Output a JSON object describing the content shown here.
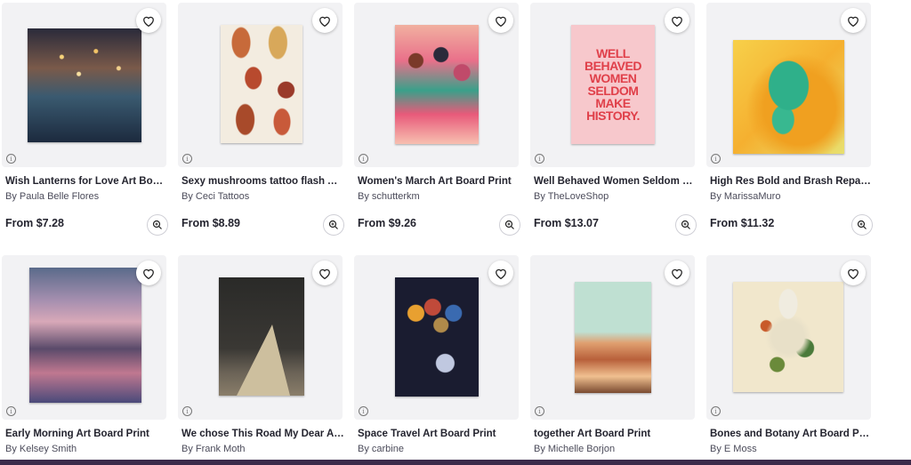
{
  "products": [
    {
      "title": "Wish Lanterns for Love Art Board Print",
      "artist": "By Paula Belle Flores",
      "price": "From $7.28",
      "heart_icon": "heart-icon",
      "zoom_icon": "zoom-in-icon"
    },
    {
      "title": "Sexy mushrooms tattoo flash Art Board Print",
      "artist": "By Ceci Tattoos",
      "price": "From $8.89",
      "heart_icon": "heart-icon",
      "zoom_icon": "zoom-in-icon"
    },
    {
      "title": "Women's March Art Board Print",
      "artist": "By schutterkm",
      "price": "From $9.26",
      "heart_icon": "heart-icon",
      "zoom_icon": "zoom-in-icon"
    },
    {
      "title": "Well Behaved Women Seldom Make History Art Board Print",
      "artist": "By TheLoveShop",
      "price": "From $13.07",
      "heart_icon": "heart-icon",
      "zoom_icon": "zoom-in-icon",
      "art_text": "WELL BEHAVED WOMEN SELDOM MAKE HISTORY."
    },
    {
      "title": "High Res Bold and Brash Repaint Art Board Print",
      "artist": "By MarissaMuro",
      "price": "From $11.32",
      "heart_icon": "heart-icon",
      "zoom_icon": "zoom-in-icon"
    },
    {
      "title": "Early Morning Art Board Print",
      "artist": "By Kelsey Smith",
      "heart_icon": "heart-icon"
    },
    {
      "title": "We chose This Road My Dear Art Board Print",
      "artist": "By Frank Moth",
      "heart_icon": "heart-icon"
    },
    {
      "title": "Space Travel Art Board Print",
      "artist": "By carbine",
      "heart_icon": "heart-icon"
    },
    {
      "title": "together Art Board Print",
      "artist": "By Michelle Borjon",
      "heart_icon": "heart-icon"
    },
    {
      "title": "Bones and Botany Art Board Print",
      "artist": "By E Moss",
      "heart_icon": "heart-icon"
    }
  ],
  "info_glyph": "i",
  "colors": {
    "accent": "#3b2a4a",
    "card_bg": "#f2f2f4"
  }
}
